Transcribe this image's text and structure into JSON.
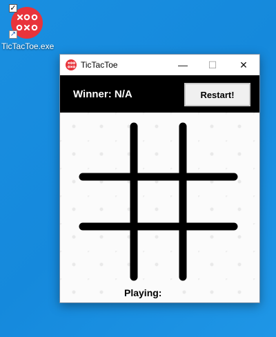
{
  "desktop": {
    "icon_name": "TicTacToe.exe",
    "icon_glyph": "xo-logo-icon"
  },
  "window": {
    "title": "TicTacToe",
    "controls": {
      "minimize": "—",
      "maximize": "☐",
      "close": "✕"
    }
  },
  "header": {
    "winner_label": "Winner: N/A",
    "restart_label": "Restart!"
  },
  "board": {
    "cells": [
      "",
      "",
      "",
      "",
      "",
      "",
      "",
      "",
      ""
    ]
  },
  "status": {
    "playing_label": "Playing:",
    "current_player": ""
  },
  "colors": {
    "desktop_bg": "#1589dc",
    "logo_red": "#e8343b",
    "header_bg": "#000000",
    "grid_lines": "#000000"
  }
}
